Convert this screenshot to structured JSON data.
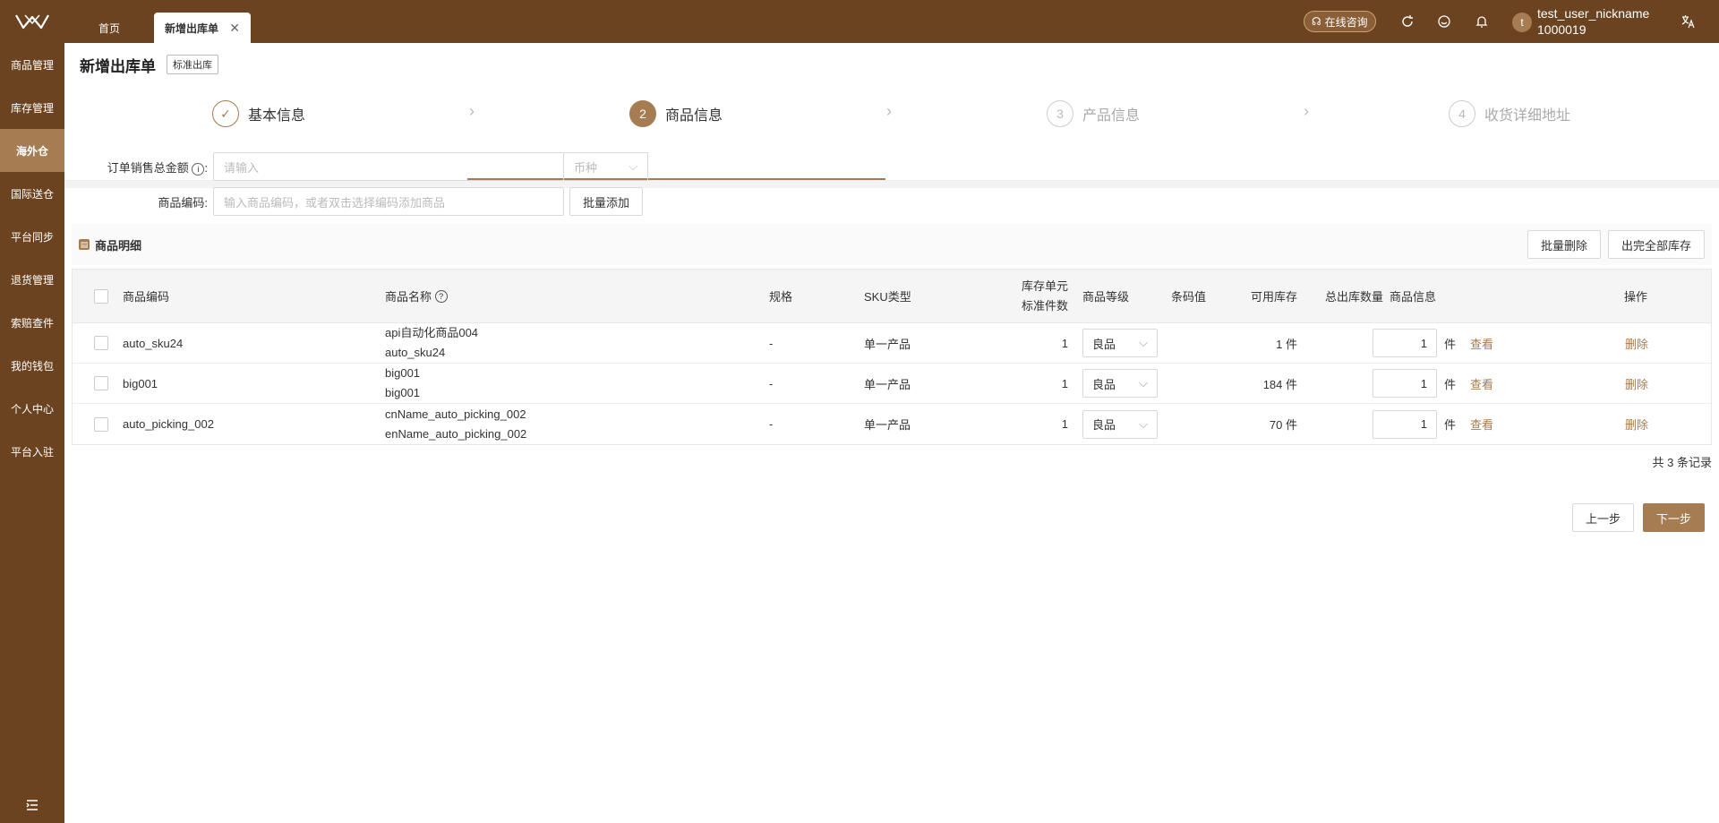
{
  "sidebar": {
    "logo_icon": "logo-icon",
    "items": [
      {
        "label": "商品管理"
      },
      {
        "label": "库存管理"
      },
      {
        "label": "海外仓"
      },
      {
        "label": "国际送仓"
      },
      {
        "label": "平台同步"
      },
      {
        "label": "退货管理"
      },
      {
        "label": "索赔查件"
      },
      {
        "label": "我的钱包"
      },
      {
        "label": "个人中心"
      },
      {
        "label": "平台入驻"
      }
    ],
    "active_index": 2
  },
  "topbar": {
    "tabs": [
      {
        "label": "首页"
      },
      {
        "label": "新增出库单"
      }
    ],
    "consult_label": "在线咨询",
    "username": "test_user_nickname",
    "user_id": "1000019",
    "avatar_letter": "t"
  },
  "page": {
    "title": "新增出库单",
    "tag": "标准出库"
  },
  "steps": [
    {
      "num": "",
      "label": "基本信息",
      "state": "done"
    },
    {
      "num": "2",
      "label": "商品信息",
      "state": "active"
    },
    {
      "num": "3",
      "label": "产品信息",
      "state": "pending"
    },
    {
      "num": "4",
      "label": "收货详细地址",
      "state": "pending"
    }
  ],
  "form": {
    "total_label": "订单销售总金额",
    "total_placeholder": "请输入",
    "currency_placeholder": "币种",
    "sku_label": "商品编码",
    "sku_placeholder": "输入商品编码，或者双击选择编码添加商品",
    "batch_add": "批量添加"
  },
  "detail": {
    "title": "商品明细",
    "batch_delete": "批量删除",
    "ship_all": "出完全部库存"
  },
  "table": {
    "headers": {
      "code": "商品编码",
      "name": "商品名称",
      "spec": "规格",
      "sku_type": "SKU类型",
      "unit_line1": "库存单元",
      "unit_line2": "标准件数",
      "grade": "商品等级",
      "barcode": "条码值",
      "available": "可用库存",
      "total_qty": "总出库数量",
      "info": "商品信息",
      "action": "操作"
    },
    "rows": [
      {
        "code": "auto_sku24",
        "name1": "api自动化商品004",
        "name2": "auto_sku24",
        "spec": "-",
        "sku_type": "单一产品",
        "unit": "1",
        "grade": "良品",
        "available": "1 件",
        "qty": "1",
        "qty_unit": "件",
        "view": "查看",
        "delete": "删除"
      },
      {
        "code": "big001",
        "name1": "big001",
        "name2": "big001",
        "spec": "-",
        "sku_type": "单一产品",
        "unit": "1",
        "grade": "良品",
        "available": "184 件",
        "qty": "1",
        "qty_unit": "件",
        "view": "查看",
        "delete": "删除"
      },
      {
        "code": "auto_picking_002",
        "name1": "cnName_auto_picking_002",
        "name2": "enName_auto_picking_002",
        "spec": "-",
        "sku_type": "单一产品",
        "unit": "1",
        "grade": "良品",
        "available": "70 件",
        "qty": "1",
        "qty_unit": "件",
        "view": "查看",
        "delete": "删除"
      }
    ]
  },
  "record_count": "共 3 条记录",
  "buttons": {
    "prev": "上一步",
    "next": "下一步"
  },
  "colors": {
    "brand": "#6b4320",
    "accent": "#a67c52"
  }
}
